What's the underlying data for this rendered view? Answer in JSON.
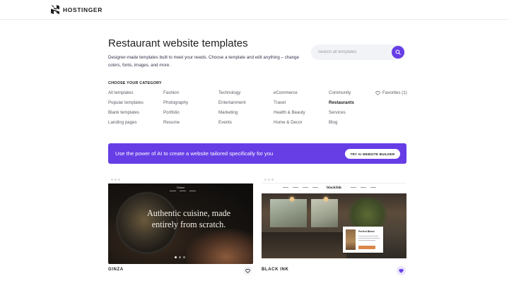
{
  "brand": {
    "name": "HOSTINGER",
    "logo_icon": "hostinger-h-logo-icon"
  },
  "page": {
    "title": "Restaurant website templates",
    "description": "Designer-made templates built to meet your needs. Choose a template and edit anything – change colors, fonts, images, and more."
  },
  "search": {
    "placeholder": "Search all templates",
    "value": "",
    "icon": "search-icon"
  },
  "categories": {
    "heading": "CHOOSE YOUR CATEGORY",
    "columns": [
      [
        "All templates",
        "Popular templates",
        "Blank templates",
        "Landing pages"
      ],
      [
        "Fashion",
        "Photography",
        "Portfolio",
        "Resume"
      ],
      [
        "Technology",
        "Entertainment",
        "Marketing",
        "Events"
      ],
      [
        "eCommerce",
        "Travel",
        "Health & Beauty",
        "Home & Decor"
      ],
      [
        "Community",
        "Restaurants",
        "Services",
        "Blog"
      ]
    ],
    "active": "Restaurants",
    "favorites_label": "Favorites (1)",
    "favorites_icon": "heart-outline-icon"
  },
  "ai_banner": {
    "text": "Use the power of AI to create a website tailored specifically for you",
    "button": "TRY AI WEBSITE BUILDER"
  },
  "templates": [
    {
      "name": "GINZA",
      "favorited": false,
      "preview": {
        "brand": "Ginza",
        "headline": "Authentic cuisine, made entirely from scratch."
      }
    },
    {
      "name": "BLACK INK",
      "favorited": true,
      "preview": {
        "brand": "blackInk",
        "card_title": "Perfect Blend"
      }
    }
  ],
  "colors": {
    "accent": "#673de6",
    "text": "#1d1e20",
    "muted": "#5c5c66",
    "favorite_bg": "#ebe4ff"
  }
}
